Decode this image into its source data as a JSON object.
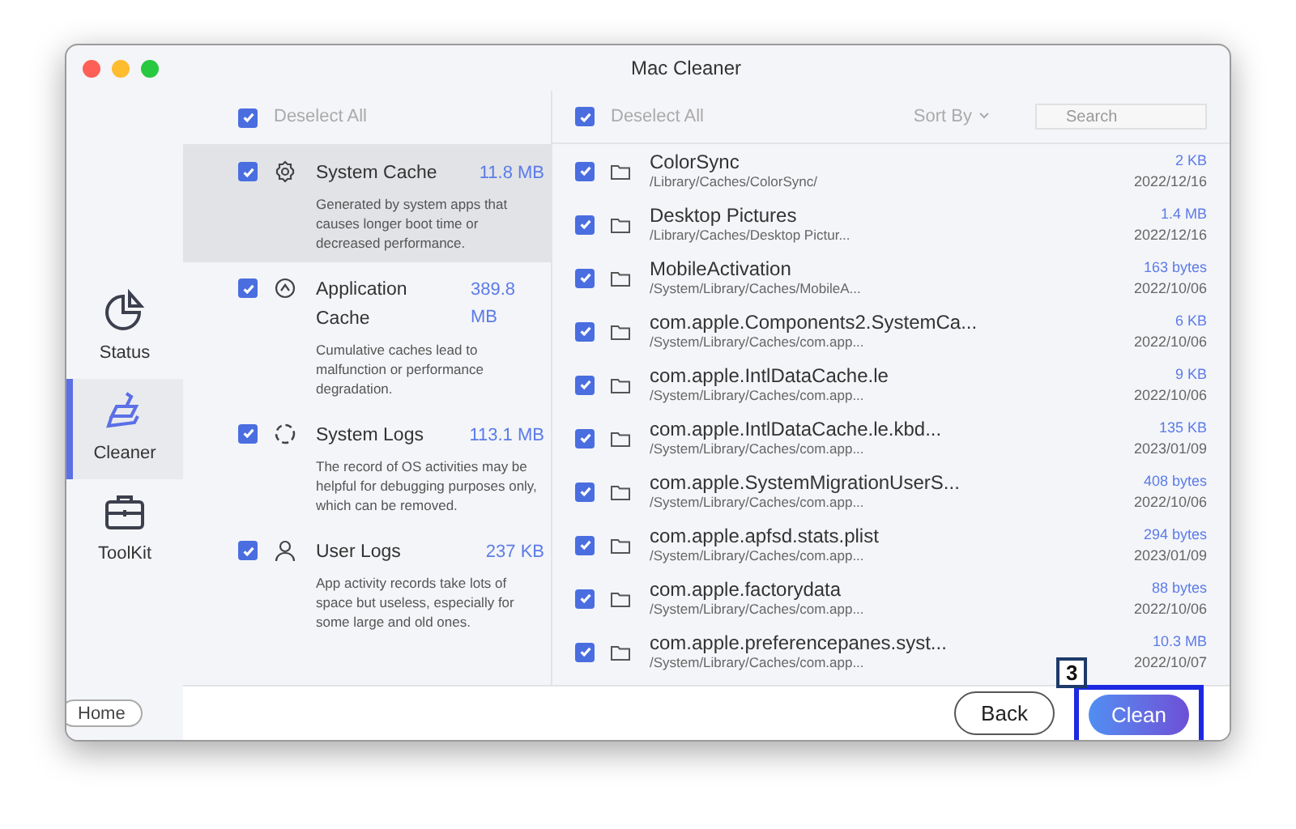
{
  "window": {
    "title": "Mac Cleaner"
  },
  "sidebar": {
    "items": [
      {
        "label": "Status",
        "selected": false
      },
      {
        "label": "Cleaner",
        "selected": true
      },
      {
        "label": "ToolKit",
        "selected": false
      }
    ],
    "home_button": "Home"
  },
  "categories": {
    "deselect_all": {
      "label": "Deselect All",
      "checked": true
    },
    "items": [
      {
        "name": "System Cache",
        "size": "11.8 MB",
        "description": "Generated by system apps that causes longer boot time or decreased performance.",
        "checked": true,
        "selected": true
      },
      {
        "name": "Application Cache",
        "size": "389.8 MB",
        "description": "Cumulative caches lead to malfunction or performance degradation.",
        "checked": true,
        "selected": false
      },
      {
        "name": "System Logs",
        "size": "113.1 MB",
        "description": "The record of OS activities may be helpful for debugging purposes only, which can be removed.",
        "checked": true,
        "selected": false
      },
      {
        "name": "User Logs",
        "size": "237 KB",
        "description": "App activity records take lots of space but useless, especially for some large and old ones.",
        "checked": true,
        "selected": false
      }
    ]
  },
  "files": {
    "deselect_all": {
      "label": "Deselect All",
      "checked": true
    },
    "sort_by": "Sort By",
    "search": {
      "placeholder": "Search"
    },
    "rows": [
      {
        "name": "ColorSync",
        "path": "/Library/Caches/ColorSync/",
        "size": "2 KB",
        "date": "2022/12/16",
        "checked": true
      },
      {
        "name": "Desktop Pictures",
        "path": "/Library/Caches/Desktop Pictur...",
        "size": "1.4 MB",
        "date": "2022/12/16",
        "checked": true
      },
      {
        "name": "MobileActivation",
        "path": "/System/Library/Caches/MobileA...",
        "size": "163 bytes",
        "date": "2022/10/06",
        "checked": true
      },
      {
        "name": "com.apple.Components2.SystemCa...",
        "path": "/System/Library/Caches/com.app...",
        "size": "6 KB",
        "date": "2022/10/06",
        "checked": true
      },
      {
        "name": "com.apple.IntlDataCache.le",
        "path": "/System/Library/Caches/com.app...",
        "size": "9 KB",
        "date": "2022/10/06",
        "checked": true
      },
      {
        "name": "com.apple.IntlDataCache.le.kbd...",
        "path": "/System/Library/Caches/com.app...",
        "size": "135 KB",
        "date": "2023/01/09",
        "checked": true
      },
      {
        "name": "com.apple.SystemMigrationUserS...",
        "path": "/System/Library/Caches/com.app...",
        "size": "408 bytes",
        "date": "2022/10/06",
        "checked": true
      },
      {
        "name": "com.apple.apfsd.stats.plist",
        "path": "/System/Library/Caches/com.app...",
        "size": "294 bytes",
        "date": "2023/01/09",
        "checked": true
      },
      {
        "name": "com.apple.factorydata",
        "path": "/System/Library/Caches/com.app...",
        "size": "88 bytes",
        "date": "2022/10/06",
        "checked": true
      },
      {
        "name": "com.apple.preferencepanes.syst...",
        "path": "/System/Library/Caches/com.app...",
        "size": "10.3 MB",
        "date": "2022/10/07",
        "checked": true
      }
    ]
  },
  "footer": {
    "back": "Back",
    "clean": "Clean",
    "step_badge": "3"
  }
}
